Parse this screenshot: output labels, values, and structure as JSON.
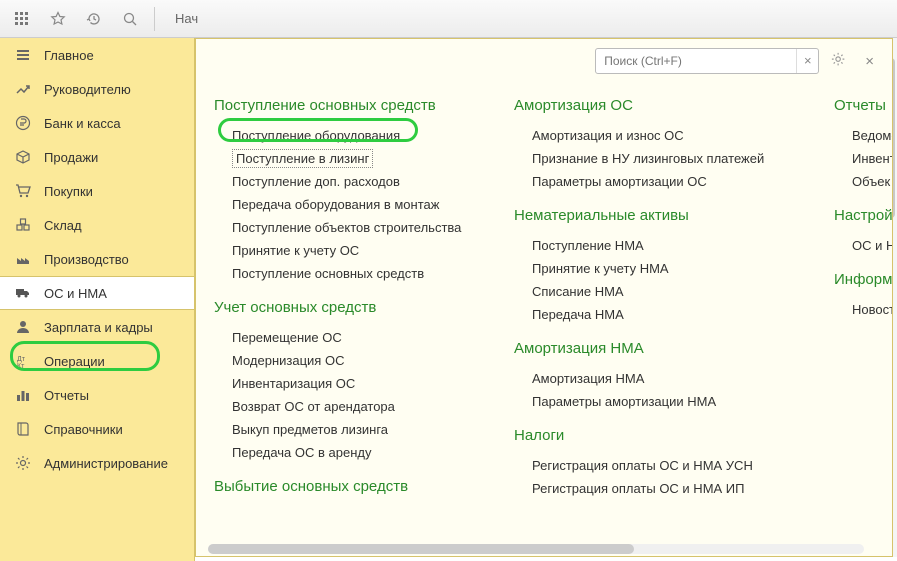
{
  "topbar": {
    "tab_label": "Нач"
  },
  "search": {
    "placeholder": "Поиск (Ctrl+F)"
  },
  "sidebar": {
    "items": [
      {
        "label": "Главное"
      },
      {
        "label": "Руководителю"
      },
      {
        "label": "Банк и касса"
      },
      {
        "label": "Продажи"
      },
      {
        "label": "Покупки"
      },
      {
        "label": "Склад"
      },
      {
        "label": "Производство"
      },
      {
        "label": "ОС и НМА"
      },
      {
        "label": "Зарплата и кадры"
      },
      {
        "label": "Операции"
      },
      {
        "label": "Отчеты"
      },
      {
        "label": "Справочники"
      },
      {
        "label": "Администрирование"
      }
    ]
  },
  "col1": {
    "g1": {
      "title": "Поступление основных средств",
      "links": [
        "Поступление оборудования",
        "Поступление в лизинг",
        "Поступление доп. расходов",
        "Передача оборудования в монтаж",
        "Поступление объектов строительства",
        "Принятие к учету ОС",
        "Поступление основных средств"
      ]
    },
    "g2": {
      "title": "Учет основных средств",
      "links": [
        "Перемещение ОС",
        "Модернизация ОС",
        "Инвентаризация ОС",
        "Возврат ОС от арендатора",
        "Выкуп предметов лизинга",
        "Передача ОС в аренду"
      ]
    },
    "g3": {
      "title": "Выбытие основных средств"
    }
  },
  "col2": {
    "g1": {
      "title": "Амортизация ОС",
      "links": [
        "Амортизация и износ ОС",
        "Признание в НУ лизинговых платежей",
        "Параметры амортизации ОС"
      ]
    },
    "g2": {
      "title": "Нематериальные активы",
      "links": [
        "Поступление НМА",
        "Принятие к учету НМА",
        "Списание НМА",
        "Передача НМА"
      ]
    },
    "g3": {
      "title": "Амортизация НМА",
      "links": [
        "Амортизация НМА",
        "Параметры амортизации НМА"
      ]
    },
    "g4": {
      "title": "Налоги",
      "links": [
        "Регистрация оплаты ОС и НМА УСН",
        "Регистрация оплаты ОС и НМА ИП"
      ]
    }
  },
  "col3": {
    "g1": {
      "title": "Отчеты",
      "links": [
        "Ведомо",
        "Инвент",
        "Объек"
      ]
    },
    "g2": {
      "title": "Настрой",
      "links": [
        "ОС и Н"
      ]
    },
    "g3": {
      "title": "Информ",
      "links": [
        "Новост"
      ]
    }
  }
}
